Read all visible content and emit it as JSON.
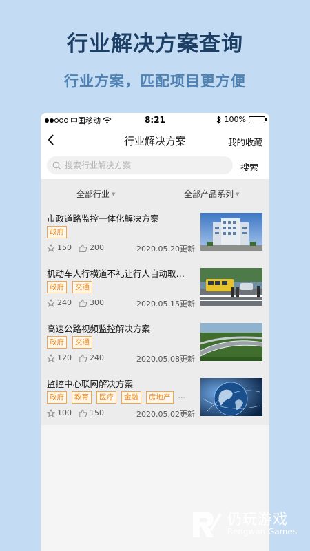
{
  "promo": {
    "title": "行业解决方案查询",
    "subtitle": "行业方案，匹配项目更方便"
  },
  "statusbar": {
    "carrier": "中国移动",
    "time": "8:21",
    "battery": "100%",
    "battery_level": 1.0
  },
  "navbar": {
    "back_icon": "chevron-left-icon",
    "title": "行业解决方案",
    "favorites": "我的收藏"
  },
  "search": {
    "placeholder": "搜索行业解决方案",
    "button": "搜索"
  },
  "filters": {
    "industry": "全部行业",
    "product_series": "全部产品系列"
  },
  "solutions": [
    {
      "title": "市政道路监控一体化解决方案",
      "tags": [
        "政府"
      ],
      "more": "",
      "stars": "150",
      "likes": "200",
      "updated": "2020.05.20更新"
    },
    {
      "title": "机动车人行横道不礼让行人自动取…",
      "tags": [
        "政府",
        "交通"
      ],
      "more": "",
      "stars": "240",
      "likes": "300",
      "updated": "2020.05.15更新"
    },
    {
      "title": "高速公路视频监控解决方案",
      "tags": [
        "政府",
        "交通"
      ],
      "more": "",
      "stars": "120",
      "likes": "240",
      "updated": "2020.05.08更新"
    },
    {
      "title": "监控中心联网解决方案",
      "tags": [
        "政府",
        "教育",
        "医疗",
        "金融",
        "房地产"
      ],
      "more": "···",
      "stars": "100",
      "likes": "150",
      "updated": "2020.05.02更新"
    }
  ],
  "watermark": {
    "cn": "仍玩游戏",
    "en": "Rengwan Games"
  },
  "colors": {
    "background": "#c3dcf3",
    "title": "#1d3f66",
    "subtitle": "#4f82b3",
    "tag_border": "#f2a74e",
    "tag_text": "#ee8b1a"
  }
}
